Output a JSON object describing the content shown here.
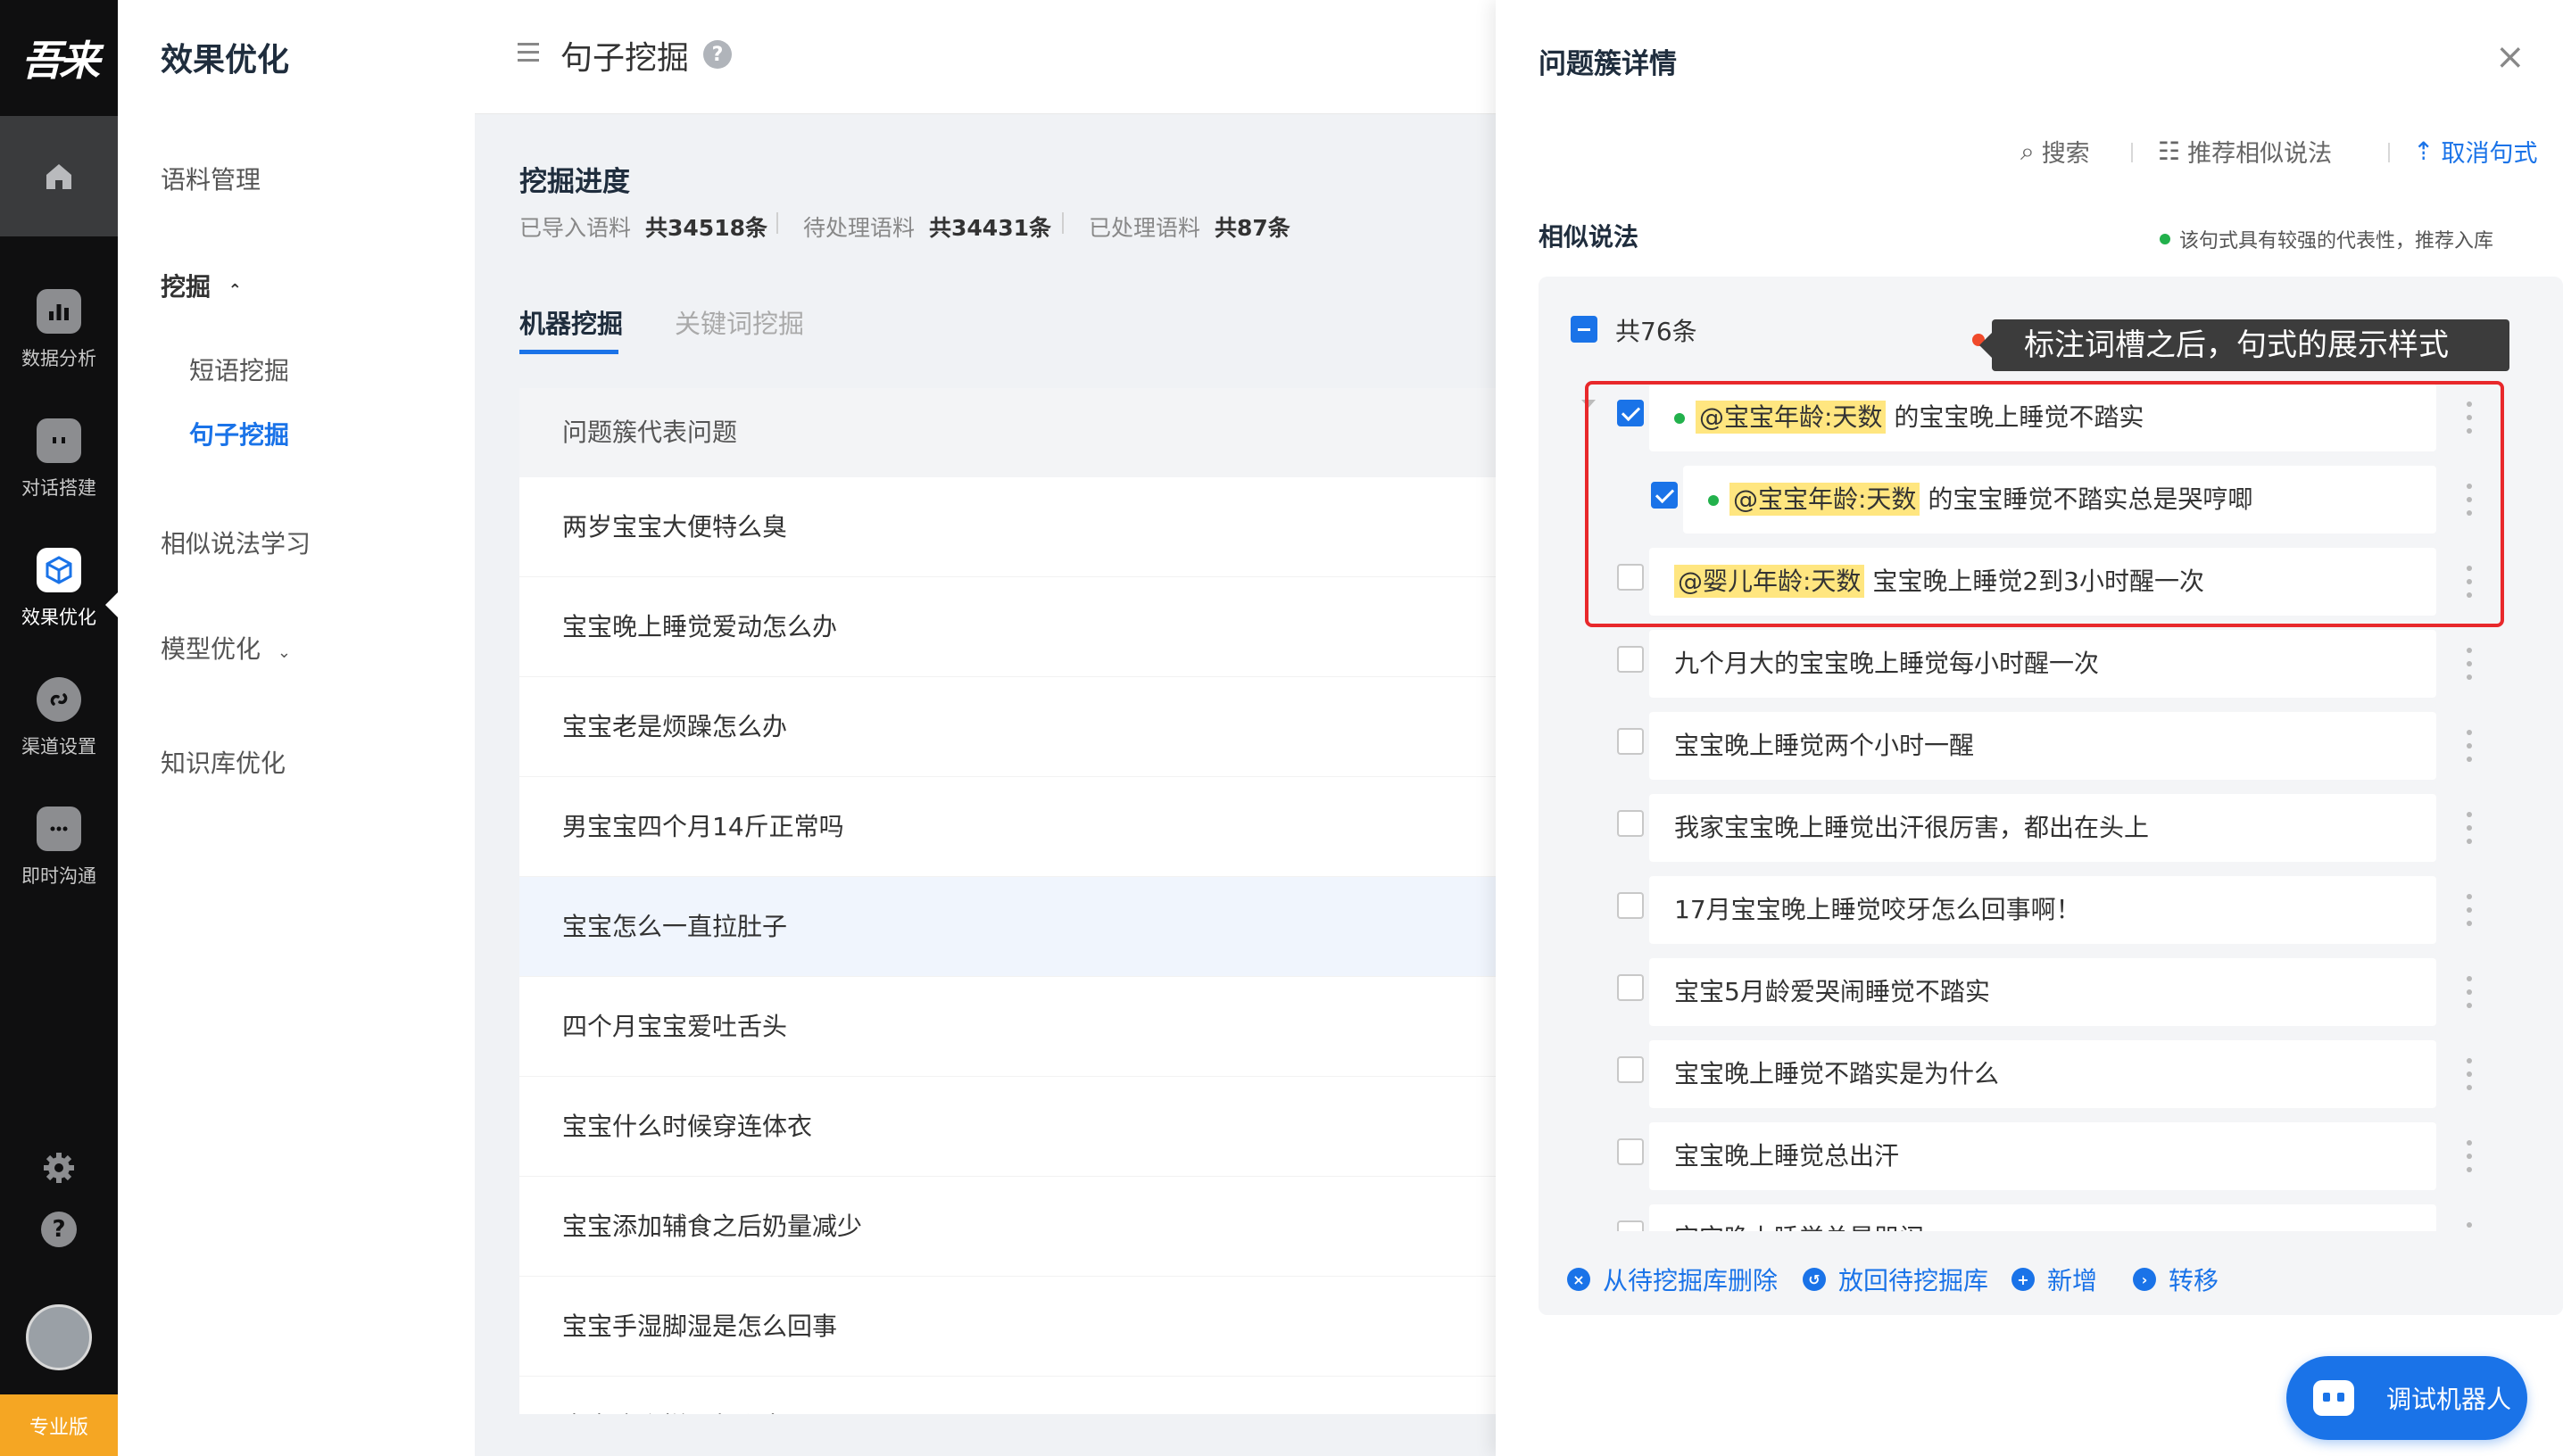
{
  "rail": {
    "logo": "吾来",
    "items": [
      {
        "label": "数据分析",
        "icon": "bar-chart-icon"
      },
      {
        "label": "对话搭建",
        "icon": "robot-icon"
      },
      {
        "label": "效果优化",
        "icon": "cube-icon"
      },
      {
        "label": "渠道设置",
        "icon": "link-icon"
      },
      {
        "label": "即时沟通",
        "icon": "chat-icon"
      }
    ],
    "edition": "专业版"
  },
  "nav": {
    "title": "效果优化",
    "corpus": "语料管理",
    "mining": "挖掘",
    "phrase_mining": "短语挖掘",
    "sentence_mining": "句子挖掘",
    "similar_learning": "相似说法学习",
    "model_opt": "模型优化",
    "kb_opt": "知识库优化"
  },
  "header": {
    "title": "句子挖掘"
  },
  "progress": {
    "title": "挖掘进度",
    "imported_label": "已导入语料",
    "imported_value": "共34518条",
    "pending_label": "待处理语料",
    "pending_value": "共34431条",
    "processed_label": "已处理语料",
    "processed_value": "共87条"
  },
  "tabs": {
    "machine": "机器挖掘",
    "keyword": "关键词挖掘"
  },
  "table": {
    "header": "问题簇代表问题",
    "rows": [
      "两岁宝宝大便特么臭",
      "宝宝晚上睡觉爱动怎么办",
      "宝宝老是烦躁怎么办",
      "男宝宝四个月14斤正常吗",
      "宝宝怎么一直拉肚子",
      "四个月宝宝爱吐舌头",
      "宝宝什么时候穿连体衣",
      "宝宝添加辅食之后奶量减少",
      "宝宝手湿脚湿是怎么回事",
      "宝宝这个样子怎么办"
    ]
  },
  "drawer": {
    "title": "问题簇详情",
    "close": "×",
    "search": "搜索",
    "recommend": "推荐相似说法",
    "cancel_pattern": "取消句式",
    "similar_label": "相似说法",
    "hint": "该句式具有较强的代表性，推荐入库",
    "total": "共76条",
    "tooltip": "标注词槽之后，句式的展示样式",
    "items": [
      {
        "tag": "@宝宝年龄:天数",
        "text": " 的宝宝晚上睡觉不踏实"
      },
      {
        "tag": "@宝宝年龄:天数",
        "text": " 的宝宝睡觉不踏实总是哭哼唧"
      },
      {
        "tag": "@婴儿年龄:天数",
        "text": " 宝宝晚上睡觉2到3小时醒一次"
      },
      {
        "text": "九个月大的宝宝晚上睡觉每小时醒一次"
      },
      {
        "text": "宝宝晚上睡觉两个小时一醒"
      },
      {
        "text": "我家宝宝晚上睡觉出汗很厉害，都出在头上"
      },
      {
        "text": "17月宝宝晚上睡觉咬牙怎么回事啊！"
      },
      {
        "text": "宝宝5月龄爱哭闹睡觉不踏实"
      },
      {
        "text": "宝宝晚上睡觉不踏实是为什么"
      },
      {
        "text": "宝宝晚上睡觉总出汗"
      },
      {
        "text": "宝宝晚上睡觉总是哭闹"
      }
    ],
    "actions": {
      "delete": "从待挖掘库删除",
      "return": "放回待挖掘库",
      "add": "新增",
      "transfer": "转移"
    }
  },
  "robot": {
    "label": "调试机器人"
  },
  "colors": {
    "accent": "#1a73e8",
    "highlight": "#ffe680",
    "annotation_red": "#e8282b",
    "rail_bg": "#0f0f10",
    "edition_badge": "#f5a623"
  }
}
